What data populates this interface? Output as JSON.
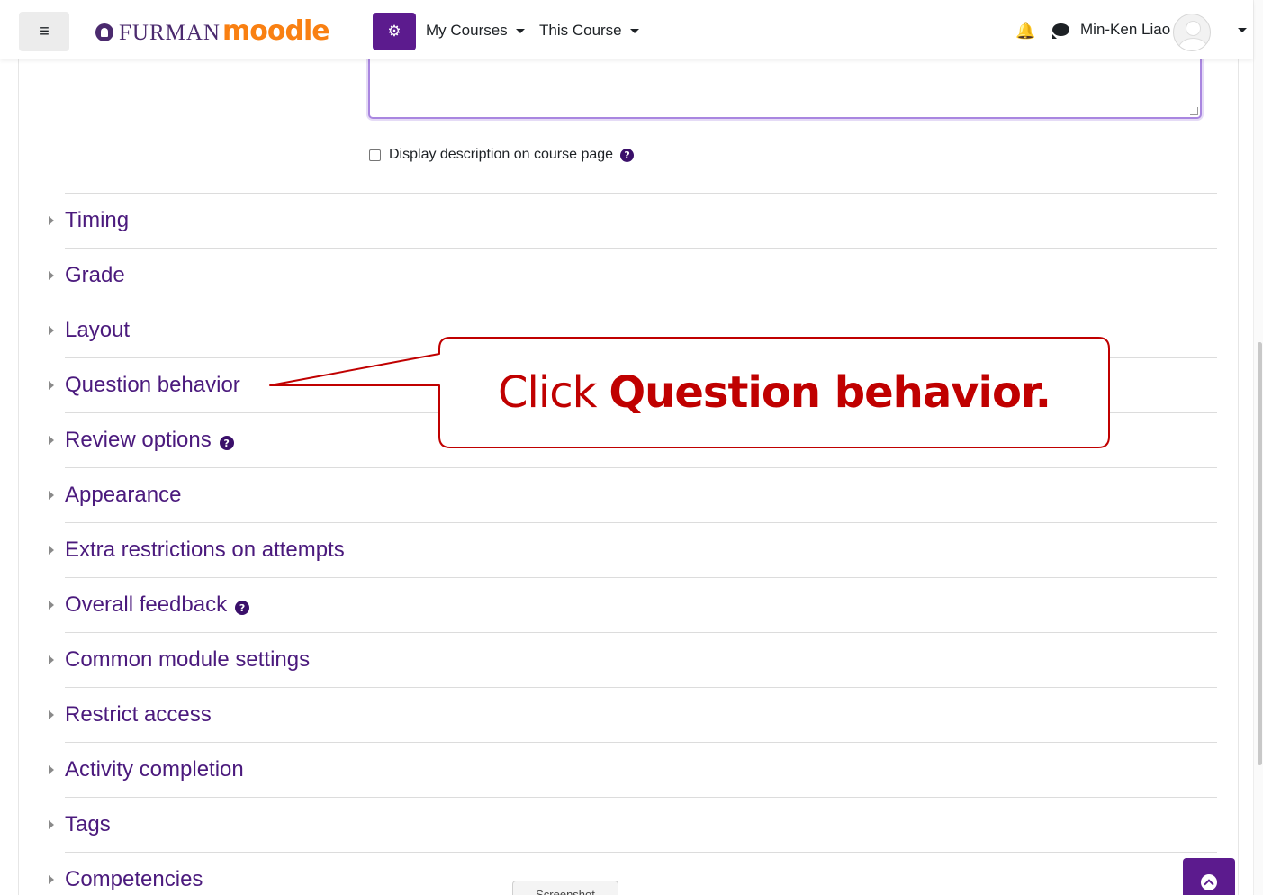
{
  "navbar": {
    "menu_icon": "hamburger-icon",
    "brand_furman": "FURMAN",
    "brand_moodle": "moodle",
    "settings_icon": "cogs-icon",
    "my_courses": "My Courses",
    "this_course": "This Course",
    "notifications_icon": "bell-icon",
    "messages_icon": "chat-bubble-icon",
    "user_name": "Min-Ken Liao",
    "brand_color": "#5c1b8e",
    "moodle_color": "#f98012"
  },
  "form": {
    "display_description_label": "Display description on course page",
    "help_icon": "?"
  },
  "sections": [
    {
      "label": "Timing",
      "help": ""
    },
    {
      "label": "Grade",
      "help": ""
    },
    {
      "label": "Layout",
      "help": ""
    },
    {
      "label": "Question behavior",
      "help": ""
    },
    {
      "label": "Review options",
      "help": "?"
    },
    {
      "label": "Appearance",
      "help": ""
    },
    {
      "label": "Extra restrictions on attempts",
      "help": ""
    },
    {
      "label": "Overall feedback",
      "help": "?"
    },
    {
      "label": "Common module settings",
      "help": ""
    },
    {
      "label": "Restrict access",
      "help": ""
    },
    {
      "label": "Activity completion",
      "help": ""
    },
    {
      "label": "Tags",
      "help": ""
    },
    {
      "label": "Competencies",
      "help": ""
    }
  ],
  "callout": {
    "prefix": "Click",
    "emphasis": "Question behavior.",
    "color": "#c00000"
  },
  "footer": {
    "screenshot_tab": "Screenshot",
    "back_to_top_icon": "arrow-up-icon"
  }
}
